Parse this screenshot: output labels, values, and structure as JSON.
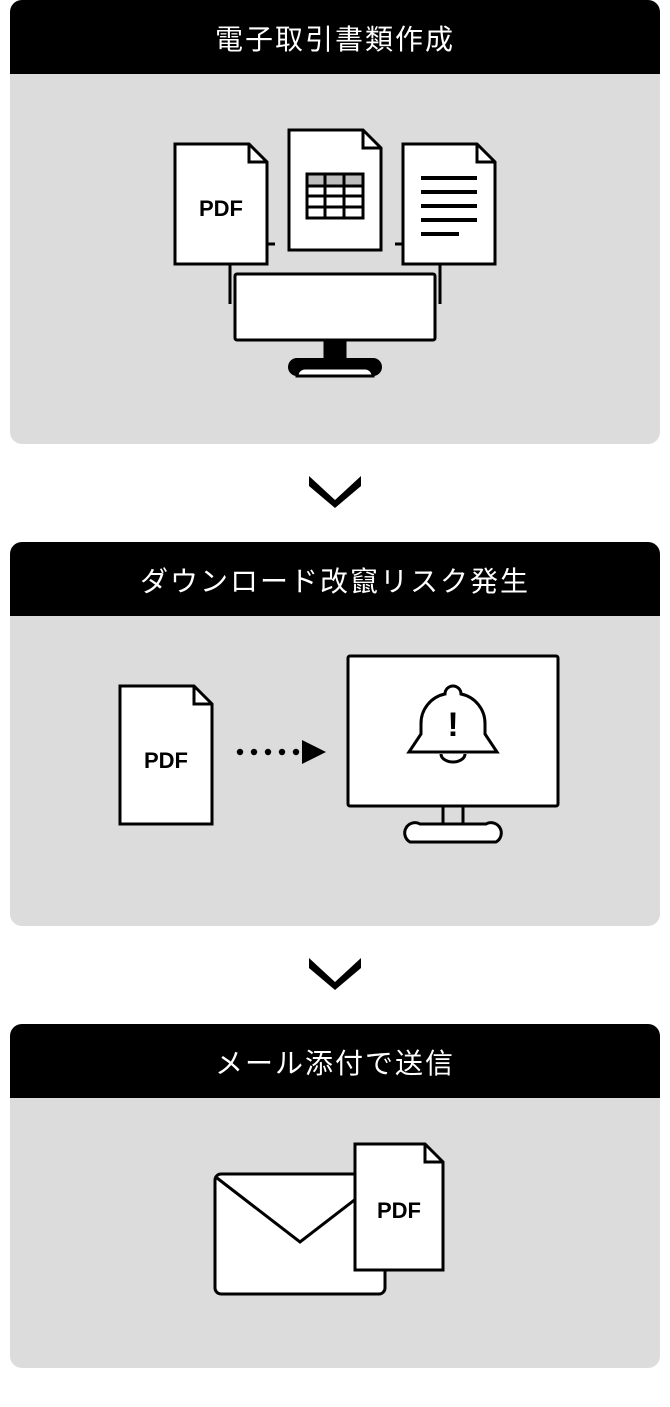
{
  "steps": [
    {
      "title": "電子取引書類作成",
      "file_label": "PDF"
    },
    {
      "title": "ダウンロード改竄リスク発生",
      "file_label": "PDF"
    },
    {
      "title": "メール添付で送信",
      "file_label": "PDF"
    }
  ]
}
